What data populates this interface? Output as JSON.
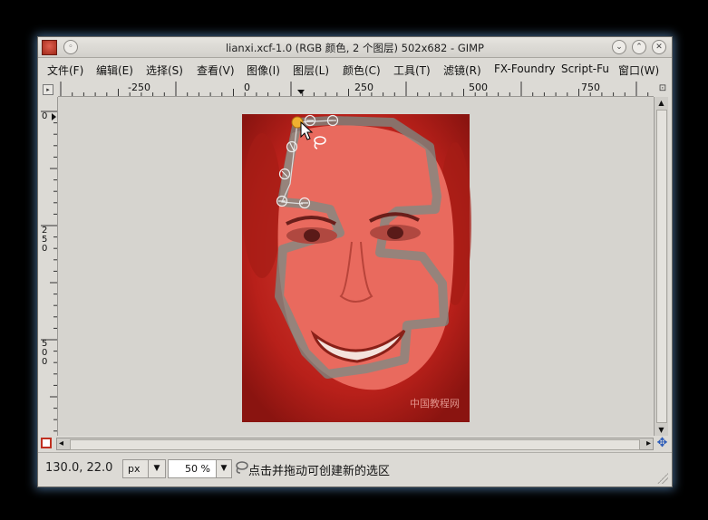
{
  "window": {
    "title": "lianxi.xcf-1.0 (RGB 颜色, 2 个图层) 502x682 - GIMP",
    "pin_glyph": "◦",
    "buttons": {
      "menu": "⌄",
      "maximize": "⌃",
      "close": "✕"
    }
  },
  "menubar": {
    "items": [
      "文件(F)",
      "编辑(E)",
      "选择(S)",
      "查看(V)",
      "图像(I)",
      "图层(L)",
      "颜色(C)",
      "工具(T)",
      "滤镜(R)",
      "FX-Foundry",
      "Script-Fu",
      "窗口(W)"
    ]
  },
  "rulers": {
    "horizontal_labels": [
      "-250",
      "0",
      "250",
      "500",
      "750"
    ],
    "vertical_labels": [
      [
        "0"
      ],
      [
        "2",
        "5",
        "0"
      ],
      [
        "5",
        "0",
        "0"
      ]
    ]
  },
  "canvas": {
    "watermark": "中国教程网"
  },
  "icons": {
    "ruler_corner": "▸",
    "zoom_corner": "⊡",
    "scroll_up": "▲",
    "scroll_down": "▼",
    "scroll_left": "◂",
    "scroll_right": "▸",
    "navigate": "✥"
  },
  "statusbar": {
    "coords": "130.0, 22.0",
    "unit": "px",
    "unit_arrow": "▼",
    "zoom": "50 %",
    "zoom_arrow": "▼",
    "message": "点击并拖动可创建新的选区"
  },
  "colors": {
    "overlay_red": "#e8302a",
    "selection_path": "#7a8c86",
    "active_node": "#f0b030"
  }
}
